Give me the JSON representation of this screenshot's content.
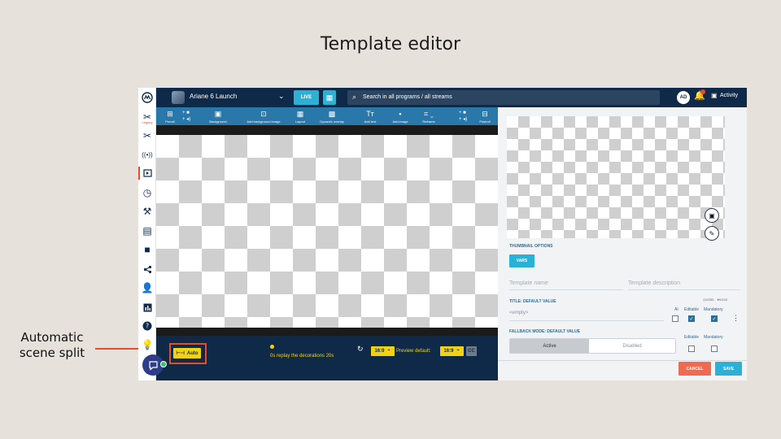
{
  "slide": {
    "title": "Template editor",
    "annotation": "Automatic scene split",
    "annotation_color": "#e84b2a"
  },
  "rail": {
    "items": [
      {
        "icon": "logo-icon"
      },
      {
        "icon": "scissors-icon",
        "sub": "Legacy"
      },
      {
        "icon": "scissors-icon"
      },
      {
        "icon": "broadcast-icon"
      },
      {
        "icon": "template-icon",
        "active": true
      },
      {
        "icon": "clock-icon"
      },
      {
        "icon": "hammer-icon"
      },
      {
        "icon": "film-icon"
      },
      {
        "icon": "camera-icon"
      },
      {
        "icon": "share-icon"
      },
      {
        "icon": "users-settings-icon"
      },
      {
        "icon": "chart-icon"
      },
      {
        "icon": "help-icon"
      },
      {
        "icon": "lightbulb-icon"
      }
    ],
    "chat_icon": "chat-icon",
    "status_color": "#3bbf6a"
  },
  "topbar": {
    "program": "Ariane 6 Launch",
    "live": "LIVE",
    "search_placeholder": "Search in all programs / all streams",
    "avatar": "AD",
    "activity": "Activity"
  },
  "toolbar": {
    "items": [
      {
        "label": "Preroll",
        "icon": "preroll-icon"
      },
      {
        "label": "Background",
        "icon": "image-icon"
      },
      {
        "label": "Add background image",
        "icon": "image-add-icon"
      },
      {
        "label": "Layout",
        "icon": "layout-icon"
      },
      {
        "label": "Dynamic overlay",
        "icon": "overlay-icon"
      },
      {
        "label": "Add text",
        "icon": "text-icon"
      },
      {
        "label": "Add image",
        "icon": "picture-icon"
      },
      {
        "label": "Reframe",
        "icon": "crop-icon"
      },
      {
        "label": "Postroll",
        "icon": "postroll-icon"
      }
    ]
  },
  "bottom": {
    "auto": "Auto",
    "replay_text": "0s replay the decorations 20s",
    "ratio": "16:9",
    "preview_label": "Preview default:",
    "preview_ratio": "16:9",
    "cc": "CC"
  },
  "panel": {
    "thumbnail_options": "THUMBNAIL OPTIONS",
    "vars": "VARS",
    "template_name_placeholder": "Template name",
    "template_description_placeholder": "Template description",
    "title_label": "TITLE: DEFAULT VALUE",
    "counter_chars": "0/255",
    "counter_short": "0/100",
    "title_empty": "<empty>",
    "col_ai": "AI",
    "col_editable": "Editable",
    "col_mandatory": "Mandatory",
    "fallback_label": "FALLBACK MODE: DEFAULT VALUE",
    "toggle_active": "Active",
    "toggle_disabled": "Disabled",
    "cancel": "CANCEL",
    "save": "SAVE"
  }
}
